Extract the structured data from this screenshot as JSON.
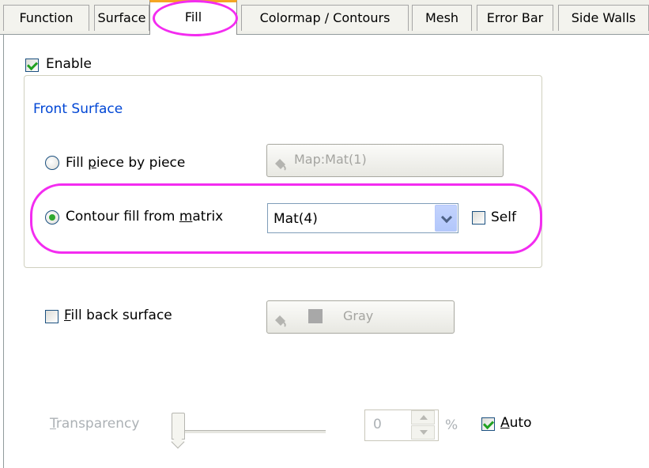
{
  "tabs": [
    {
      "label": "Function",
      "active": false
    },
    {
      "label": "Surface",
      "active": false
    },
    {
      "label": "Fill",
      "active": true
    },
    {
      "label": "Colormap / Contours",
      "active": false
    },
    {
      "label": "Mesh",
      "active": false
    },
    {
      "label": "Error Bar",
      "active": false
    },
    {
      "label": "Side Walls",
      "active": false
    }
  ],
  "enable": {
    "label": "Enable",
    "checked": true
  },
  "front_surface": {
    "title": "Front Surface",
    "fill_piece": {
      "pre": "Fill ",
      "mnemonic": "p",
      "post": "iece by piece",
      "selected": false
    },
    "map_button": "Map:Mat(1)",
    "contour_fill": {
      "pre": "Contour fill from ",
      "mnemonic": "m",
      "post": "atrix",
      "selected": true
    },
    "matrix_combo": {
      "value": "Mat(4)"
    },
    "self": {
      "label": "Self",
      "checked": false
    }
  },
  "fill_back": {
    "mnemonic": "F",
    "post": "ill back surface",
    "checked": false
  },
  "gray_button": "Gray",
  "transparency": {
    "mnemonic": "T",
    "post": "ransparency",
    "value": "0",
    "unit": "%",
    "level": 0
  },
  "auto": {
    "mnemonic": "A",
    "post": "uto",
    "checked": true
  },
  "colors": {
    "highlight": "#f32cf0",
    "group_title": "#0046d5",
    "check": "#21a121"
  }
}
